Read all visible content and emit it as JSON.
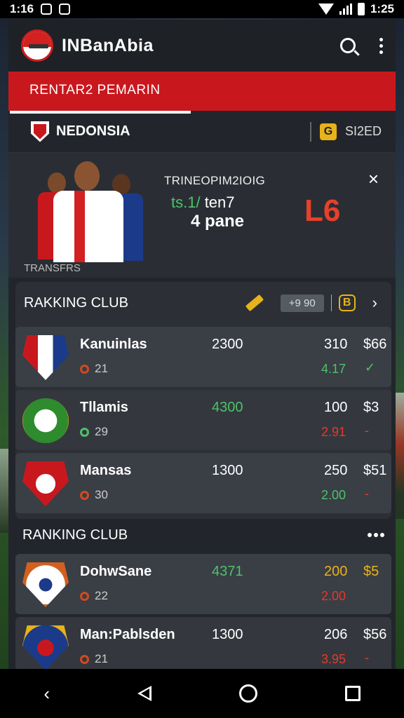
{
  "status": {
    "time_left": "1:16",
    "time_right": "1:25"
  },
  "app": {
    "title": "INBanAbia"
  },
  "tabs": {
    "active": "RENTAR2 PEMARIN"
  },
  "section": {
    "title": "NEDONSIA",
    "right_label": "SI2ED",
    "right_icon_text": "G"
  },
  "feature": {
    "heading": "TRINEOPIM2IOIG",
    "line1_green": "ts.1/",
    "line1_white": " ten7",
    "line2": "4 pane",
    "score": "L6",
    "close_glyph": "×",
    "caption": "TRANSFRS"
  },
  "ranking_1": {
    "title": "RAKKING CLUB",
    "chip": "+9 90",
    "badge": "B",
    "chevron": "›"
  },
  "clubs_1": [
    {
      "name": "Kanuinlas",
      "sub": "21",
      "a": "2300",
      "b": "310",
      "c": "$66",
      "d": "4.17",
      "e": "✓",
      "d_color": "green",
      "e_color": "green",
      "a_color": "",
      "dot": "orange"
    },
    {
      "name": "Tllamis",
      "sub": "29",
      "a": "4300",
      "b": "100",
      "c": "$3",
      "d": "2.91",
      "e": "-",
      "d_color": "red",
      "e_color": "red",
      "a_color": "green",
      "dot": "green"
    },
    {
      "name": "Mansas",
      "sub": "30",
      "a": "1300",
      "b": "250",
      "c": "$51",
      "d": "2.00",
      "e": "-",
      "d_color": "green",
      "e_color": "red",
      "a_color": "",
      "dot": "orange"
    }
  ],
  "ranking_2": {
    "title": "RANKING CLUB"
  },
  "clubs_2": [
    {
      "name": "DohwSane",
      "sub": "22",
      "a": "4371",
      "b": "200",
      "c": "$5",
      "d": "2.00",
      "e": "",
      "d_color": "red",
      "e_color": "",
      "a_color": "green",
      "b_color": "yellow",
      "c_color": "yellow",
      "dot": "orange"
    },
    {
      "name": "Man:Pablsden",
      "sub": "21",
      "a": "1300",
      "b": "206",
      "c": "$56",
      "d": "3.95",
      "e": "-",
      "d_color": "red",
      "e_color": "red",
      "a_color": "",
      "dot": "orange"
    }
  ],
  "colors": {
    "accent_red": "#c8181e",
    "accent_yellow": "#e8b21a",
    "positive": "#4cc36a",
    "negative": "#e33a2a"
  },
  "nav": {
    "back": "‹"
  }
}
